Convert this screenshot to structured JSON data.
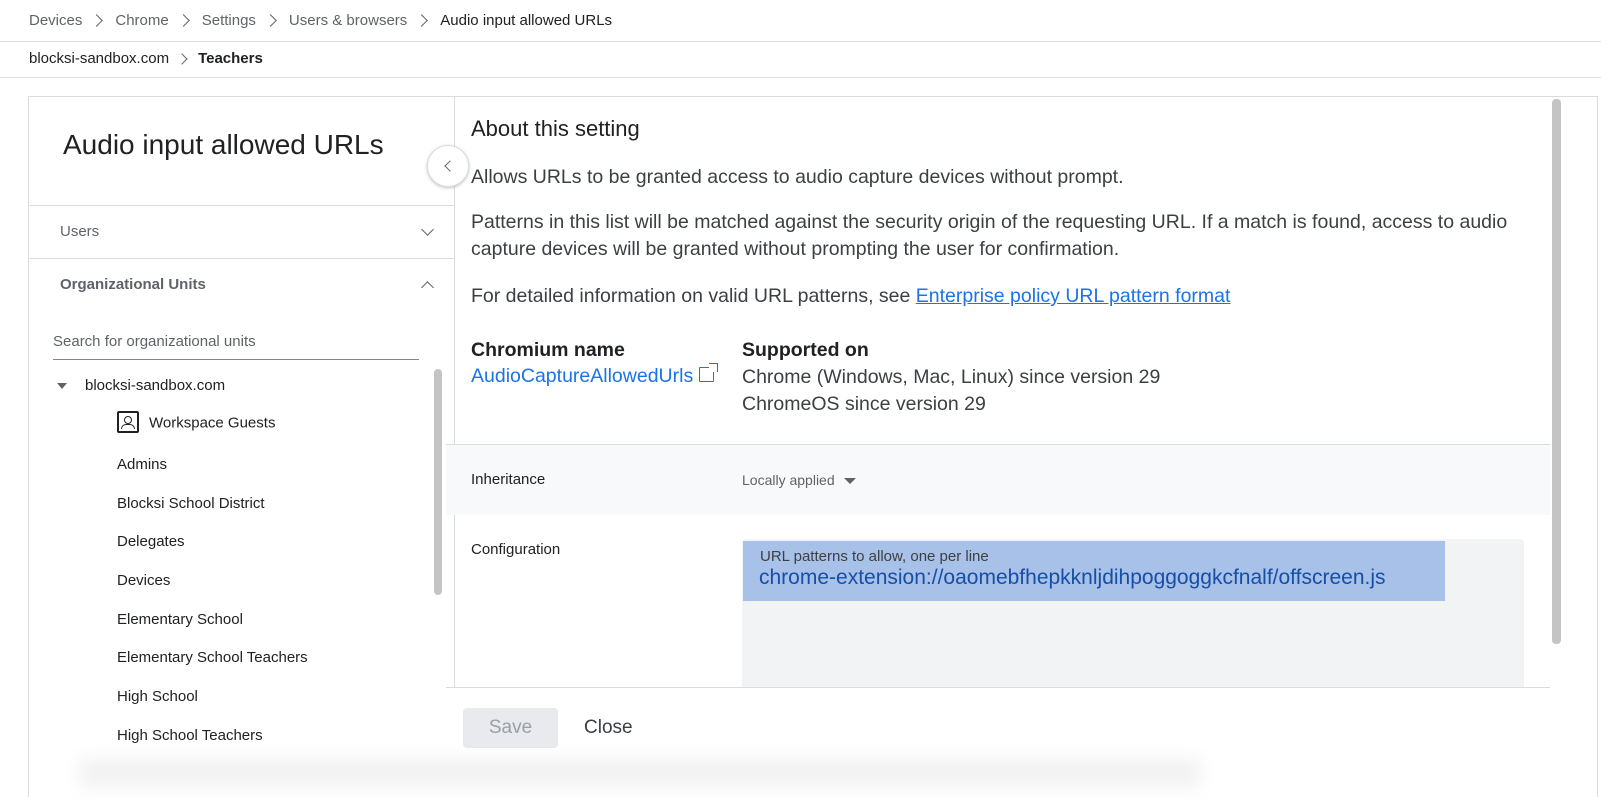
{
  "breadcrumb": [
    "Devices",
    "Chrome",
    "Settings",
    "Users & browsers",
    "Audio input allowed URLs"
  ],
  "org_breadcrumb": {
    "root": "blocksi-sandbox.com",
    "current": "Teachers"
  },
  "left_panel": {
    "title": "Audio input allowed URLs",
    "sections": {
      "users": "Users",
      "org_units": "Organizational Units"
    },
    "search_placeholder": "Search for organizational units",
    "tree_root": "blocksi-sandbox.com",
    "tree_items": [
      "Workspace Guests",
      "Admins",
      "Blocksi School District",
      "Delegates",
      "Devices",
      "Elementary School",
      "Elementary School Teachers",
      "High School",
      "High School Teachers"
    ]
  },
  "right_panel": {
    "heading": "About this setting",
    "description": "Allows URLs to be granted access to audio capture devices without prompt.",
    "details": "Patterns in this list will be matched against the security origin of the requesting URL. If a match is found, access to audio capture devices will be granted without prompting the user for confirmation.",
    "info_prefix": "For detailed information on valid URL patterns, see ",
    "info_link": "Enterprise policy URL pattern format",
    "chromium_name_label": "Chromium name",
    "chromium_name_value": "AudioCaptureAllowedUrls",
    "supported_on_label": "Supported on",
    "supported_on": [
      "Chrome (Windows, Mac, Linux) since version 29",
      "ChromeOS since version 29"
    ],
    "inheritance_label": "Inheritance",
    "inheritance_value": "Locally applied",
    "configuration_label": "Configuration",
    "textarea_placeholder": "URL patterns to allow, one per line",
    "textarea_value": "chrome-extension://oaomebfhepkknljdihpoggoggkcfnalf/offscreen.js"
  },
  "footer": {
    "save": "Save",
    "close": "Close"
  },
  "icons": [
    "chevron-right-icon",
    "chevron-left-icon",
    "chevron-down-icon",
    "chevron-up-icon",
    "triangle-down-icon",
    "guest-badge-icon",
    "external-link-icon",
    "dropdown-arrow-icon"
  ]
}
